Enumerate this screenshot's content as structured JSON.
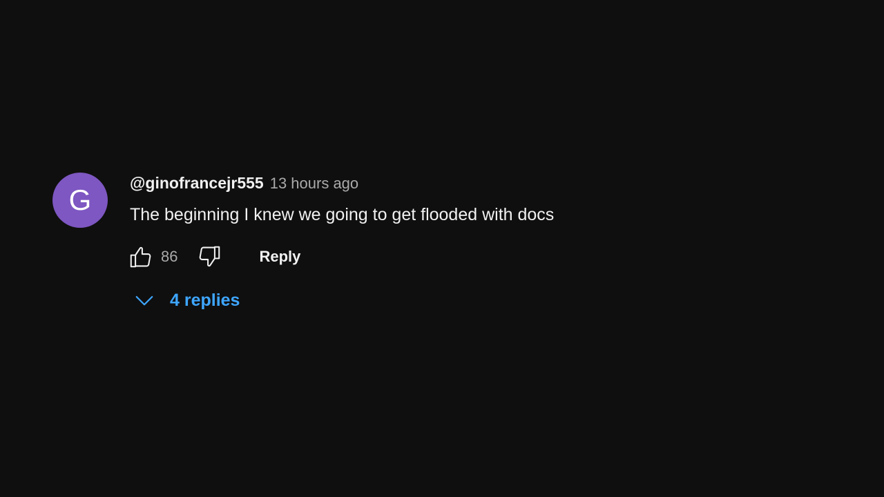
{
  "comment": {
    "avatar": {
      "initial": "G",
      "color": "#7e57c2"
    },
    "author": "@ginofrancejr555",
    "timestamp": "13 hours ago",
    "text": "The beginning I knew we going to get flooded with docs",
    "actions": {
      "like_icon": "thumbs-up-icon",
      "like_count": "86",
      "dislike_icon": "thumbs-down-icon",
      "reply_label": "Reply"
    },
    "replies": {
      "icon": "chevron-down-icon",
      "label": "4 replies",
      "color": "#3ea6ff"
    }
  }
}
